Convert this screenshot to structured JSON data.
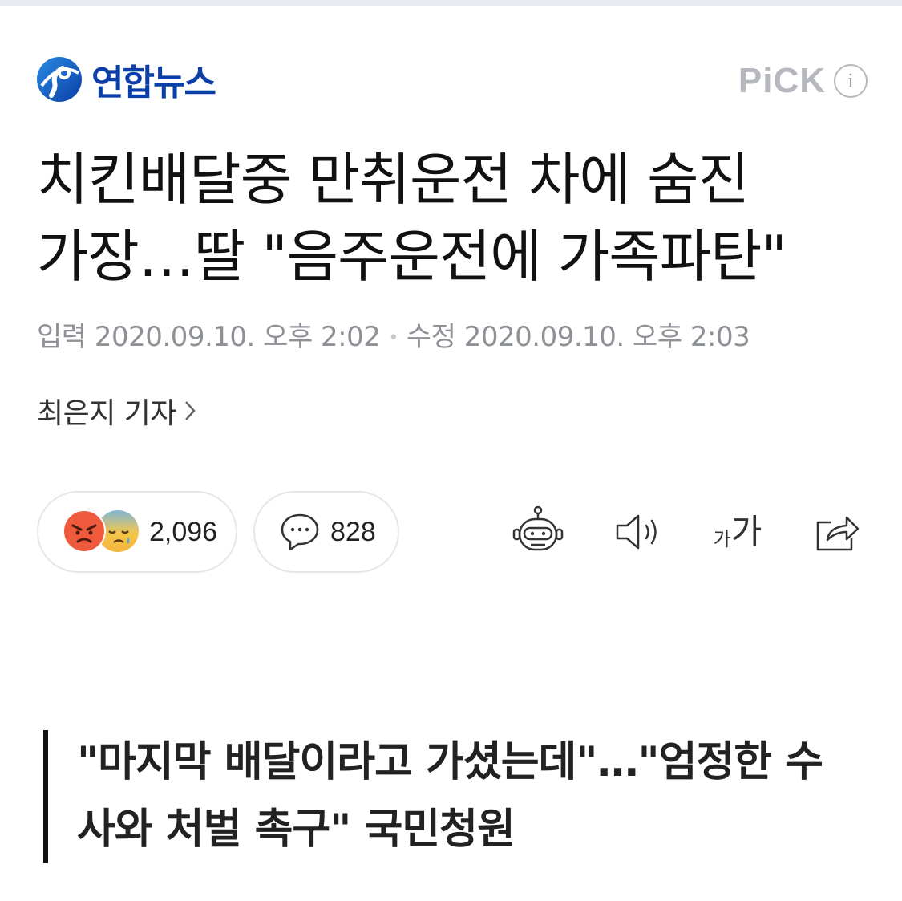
{
  "brand": {
    "name": "연합뉴스",
    "logo_icon": "yonhap-logo-icon",
    "accent_color": "#0b3ea7"
  },
  "pick": {
    "label": "PiCK",
    "info_icon": "info-icon",
    "info_glyph": "i"
  },
  "article": {
    "headline_line1": "치킨배달중 만취운전 차에 숨진",
    "headline_line2": "가장…딸 \"음주운전에 가족파탄\"",
    "input_label": "입력",
    "input_time": "2020.09.10. 오후 2:02",
    "separator": "•",
    "edit_label": "수정",
    "edit_time": "2020.09.10. 오후 2:03",
    "reporter": "최은지 기자"
  },
  "reactions": {
    "count": "2,096",
    "icons": [
      "angry-emoji-icon",
      "sad-emoji-icon"
    ]
  },
  "comments": {
    "count": "828",
    "icon": "speech-bubble-icon"
  },
  "toolbar": {
    "items": [
      {
        "icon": "robot-summary-icon"
      },
      {
        "icon": "speaker-icon"
      },
      {
        "icon": "font-size-icon",
        "label_small": "가",
        "label_large": "가"
      },
      {
        "icon": "share-icon"
      }
    ]
  },
  "subheadline": {
    "line1": "\"마지막 배달이라고 가셨는데\"…\"엄정한 수",
    "line2": "사와 처벌 촉구\" 국민청원"
  }
}
